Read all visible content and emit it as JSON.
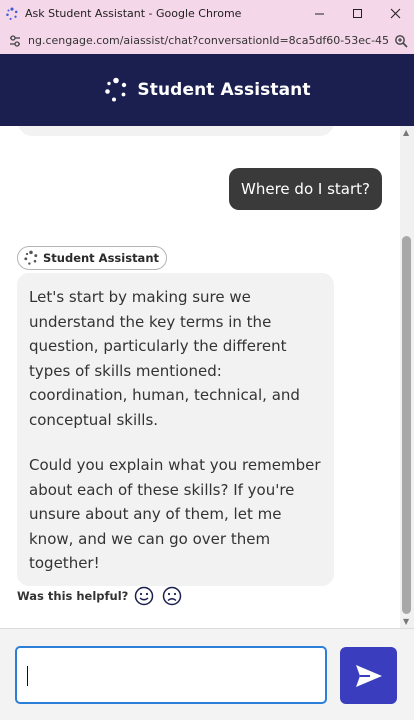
{
  "window": {
    "title": "Ask Student Assistant - Google Chrome",
    "url": "ng.cengage.com/aiassist/chat?conversationId=8ca5df60-53ec-456..."
  },
  "header": {
    "title": "Student Assistant"
  },
  "chat": {
    "user_message": "Where do I start?",
    "assistant_label": "Student Assistant",
    "assistant_paragraphs": [
      "Let's start by making sure we understand the key terms in the question, particularly the different types of skills mentioned: coordination, human, technical, and conceptual skills.",
      "Could you explain what you remember about each of these skills? If you're unsure about any of them, let me know, and we can go over them together!"
    ],
    "feedback_label": "Was this helpful?"
  },
  "input": {
    "value": "",
    "placeholder": ""
  },
  "colors": {
    "titlebar": "#f5d7ea",
    "header": "#1a1f4f",
    "user_bubble": "#3a3a3a",
    "assistant_bubble": "#f2f2f2",
    "send_button": "#3a3dbd",
    "input_focus": "#2d7ed8"
  },
  "icons": {
    "app": "cengage-dots-icon",
    "site_settings": "tune-icon",
    "zoom": "zoom-icon",
    "minimize": "minimize-icon",
    "maximize": "maximize-icon",
    "close": "close-icon",
    "send": "send-icon",
    "thumbs_up": "smile-face-icon",
    "thumbs_down": "frown-face-icon"
  }
}
